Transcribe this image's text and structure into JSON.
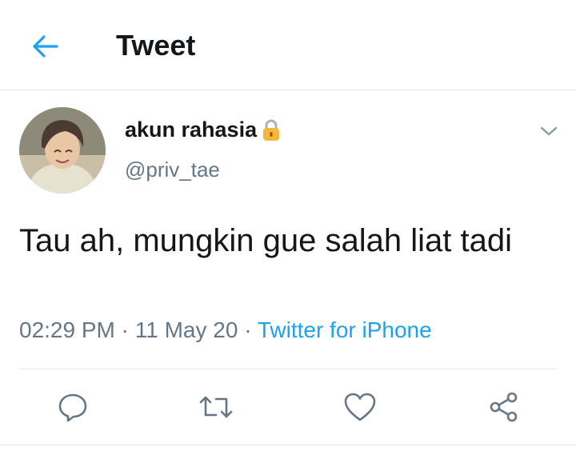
{
  "header": {
    "title": "Tweet",
    "back_icon": "arrow-left-icon"
  },
  "author": {
    "display_name": "akun rahasia",
    "handle": "@priv_tae",
    "badge_icon": "lock-icon"
  },
  "tweet": {
    "text": "Tau ah, mungkin gue salah liat tadi",
    "time": "02:29 PM",
    "separator1": " · ",
    "date": "11 May 20",
    "separator2": " · ",
    "source": "Twitter for iPhone"
  },
  "actions": [
    {
      "icon": "reply-icon"
    },
    {
      "icon": "retweet-icon"
    },
    {
      "icon": "like-icon"
    },
    {
      "icon": "share-icon"
    }
  ],
  "colors": {
    "accent": "#1da1f2",
    "text": "#14171a",
    "muted": "#657786",
    "divider": "#e1e8ed"
  }
}
